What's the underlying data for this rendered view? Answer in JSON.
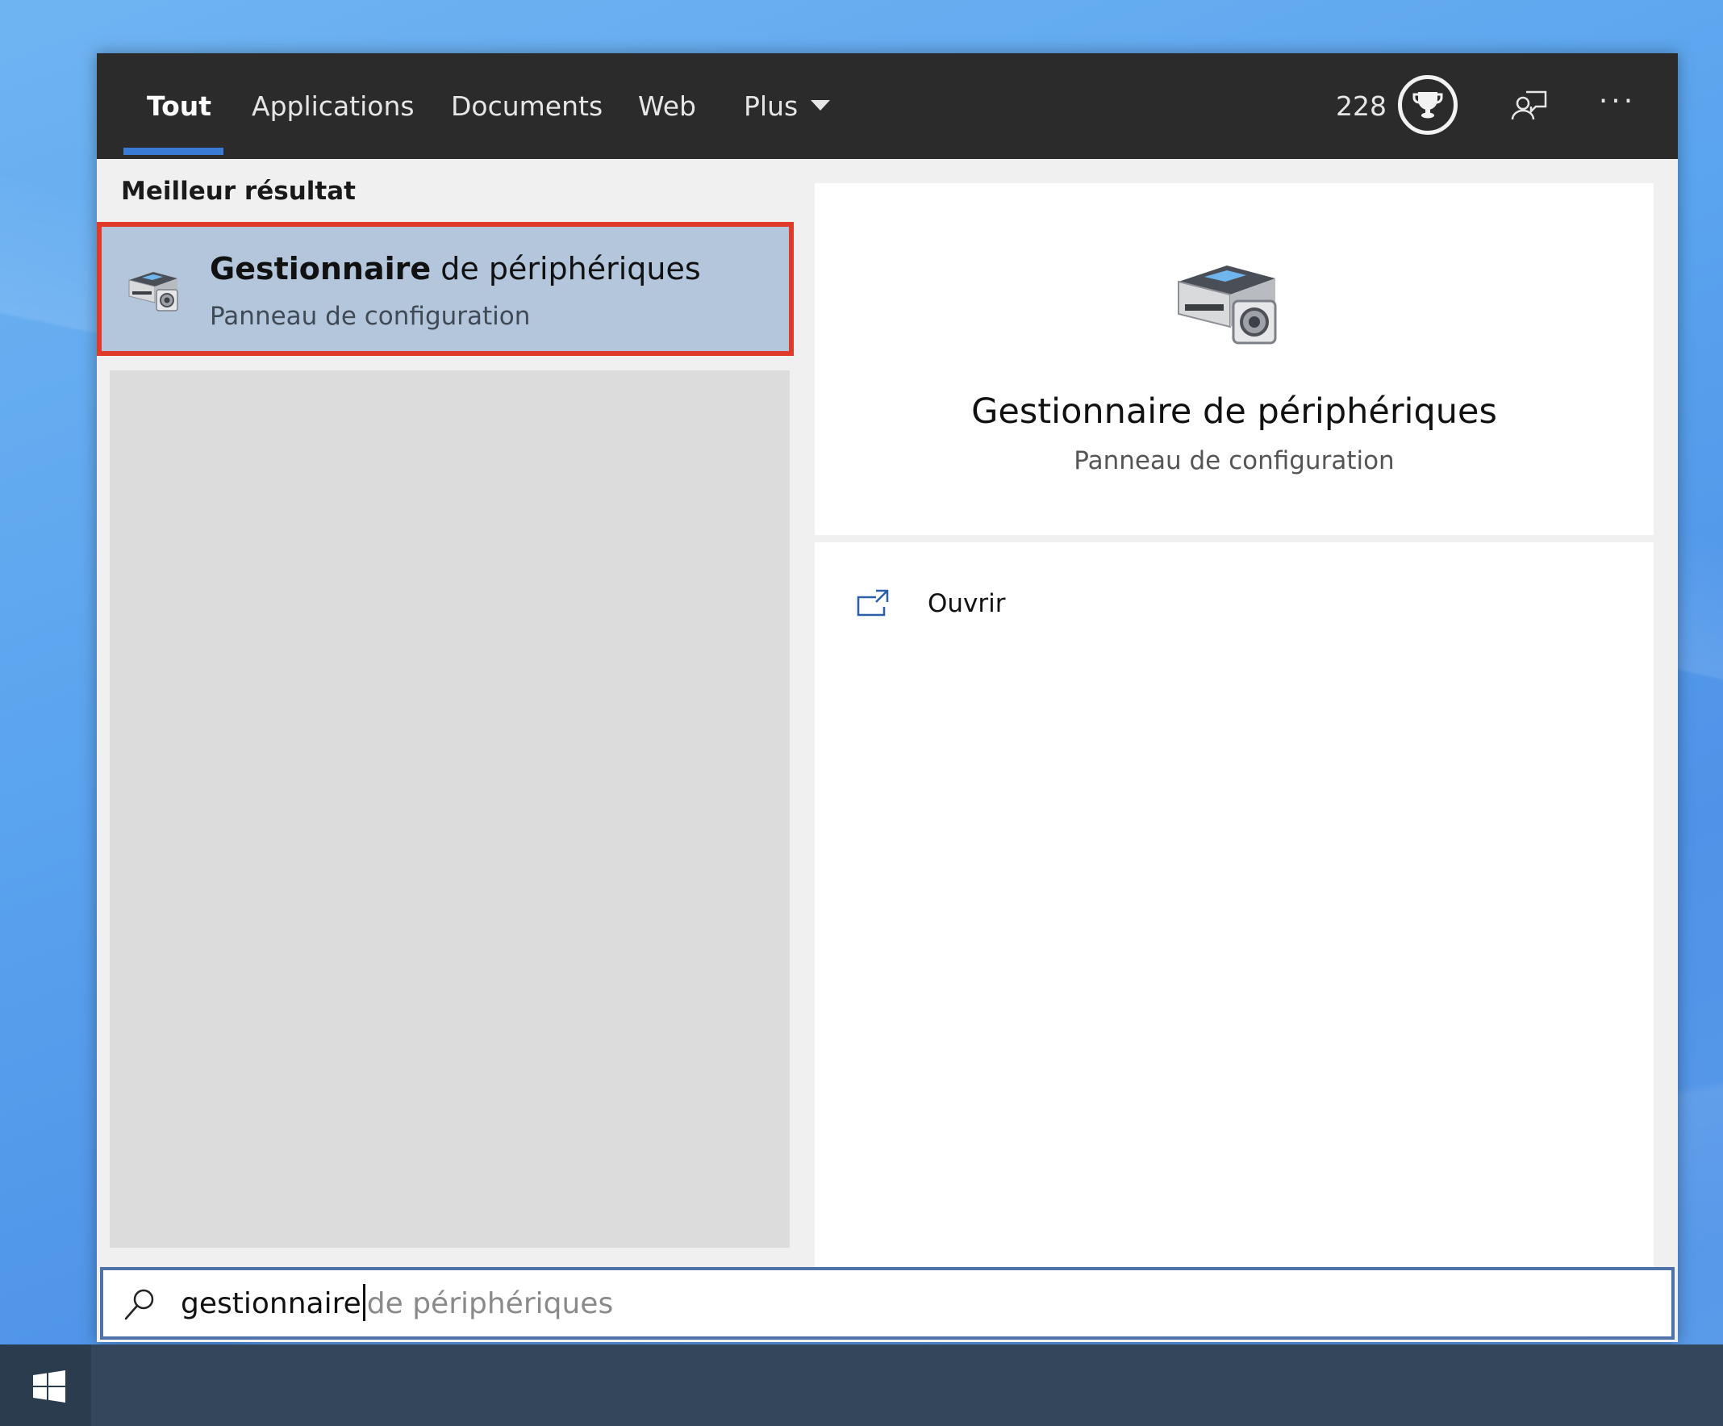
{
  "tabs": [
    {
      "label": "Tout",
      "active": true
    },
    {
      "label": "Applications",
      "active": false
    },
    {
      "label": "Documents",
      "active": false
    },
    {
      "label": "Web",
      "active": false
    },
    {
      "label": "Plus",
      "active": false
    }
  ],
  "header": {
    "points": "228",
    "icons": [
      "trophy-icon",
      "feedback-icon",
      "more-icon"
    ],
    "more_label": "···"
  },
  "results": {
    "section_title": "Meilleur résultat",
    "best": {
      "title_bold": "Gestionnaire",
      "title_rest": " de périphériques",
      "subtitle": "Panneau de configuration",
      "icon": "device-manager-icon"
    }
  },
  "preview": {
    "title": "Gestionnaire de périphériques",
    "subtitle": "Panneau de configuration",
    "icon": "device-manager-icon",
    "actions": [
      {
        "label": "Ouvrir",
        "icon": "open-icon"
      }
    ]
  },
  "search": {
    "typed": "gestionnaire",
    "suggestion": "de périphériques",
    "icon": "search-icon"
  },
  "taskbar": {
    "start_icon": "windows-logo-icon"
  },
  "colors": {
    "topbar": "#2b2b2b",
    "accent": "#3a7bd5",
    "selected_result": "#b3c6dc",
    "highlight_border": "#e03a2a",
    "taskbar": "#34465b"
  }
}
